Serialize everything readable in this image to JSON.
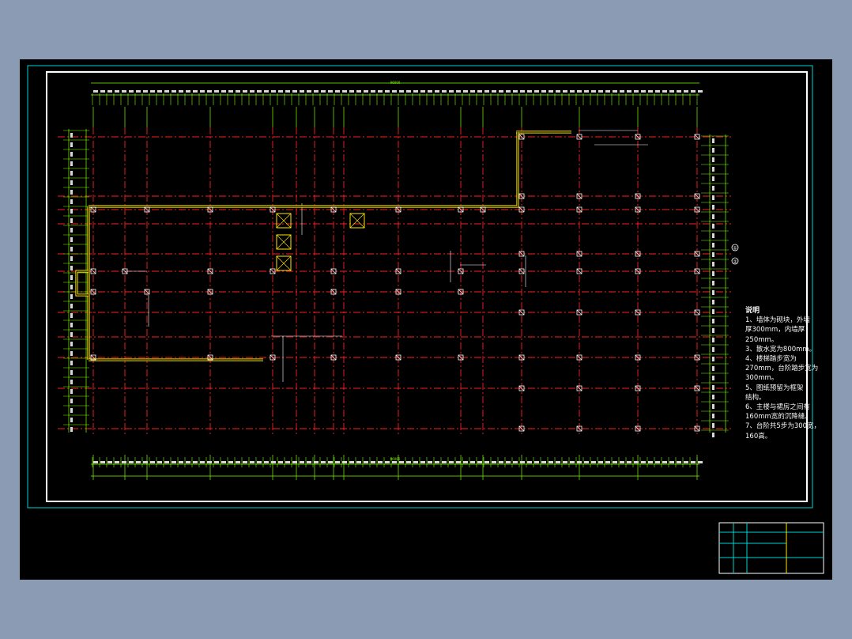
{
  "drawing": {
    "background": "#000000",
    "frame_color": "#00d4d4",
    "inner_frame_color": "#ffffff",
    "dimension_color": "#7cfc00",
    "grid_color": "#ff2020",
    "wall_color": "#ffe600",
    "column_color": "#ffffff",
    "top_dimension_total": "96000",
    "bottom_dimension_total": "96000"
  },
  "notes": {
    "title": "说明",
    "lines": [
      "1、墙体为砌块，外墙",
      "厚300mm，内墙厚",
      "250mm。",
      "3、散水宽为800mm。",
      "4、楼梯踏步宽为",
      "270mm，台阶踏步宽为",
      "300mm。",
      "5、图纸预留为框架",
      "结构。",
      "6、主楼与裙房之间有",
      "160mm宽的沉降缝。",
      "7、台阶共5步为300宽，",
      "160高。"
    ]
  },
  "axis_bubbles": [
    "①",
    "②"
  ],
  "title_block": {
    "label": ""
  }
}
